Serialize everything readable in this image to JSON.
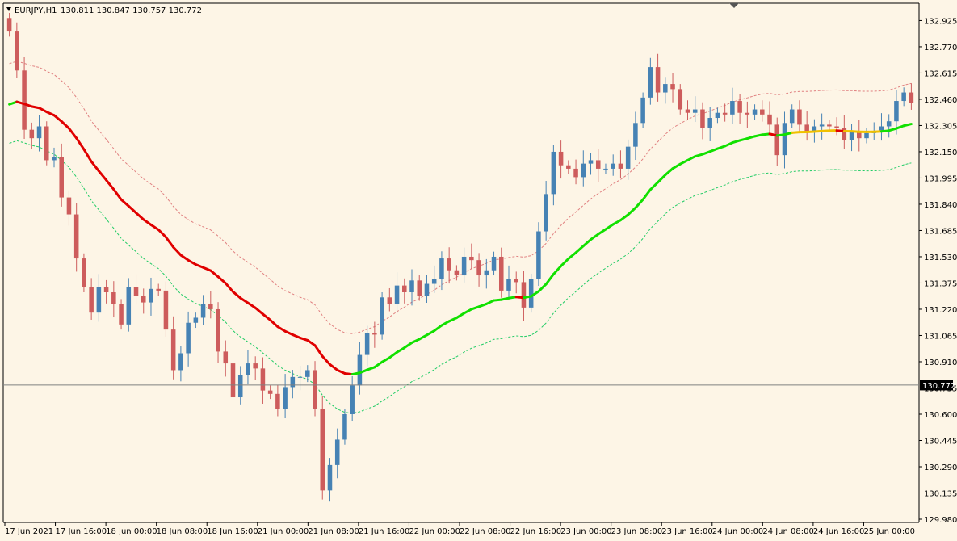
{
  "header": {
    "symbol": "EURJPY,H1",
    "ohlc": "130.811 130.847 130.757 130.772"
  },
  "colors": {
    "background": "#fdf5e6",
    "bull_candle": "#4682b4",
    "bear_candle": "#cd5c5c",
    "ma_down": "#e00000",
    "ma_up": "#11e000",
    "ma_flat": "#f0c000",
    "upper_band": "#e08080",
    "lower_band": "#22cc66",
    "price_line": "#808080"
  },
  "chart_data": {
    "type": "candlestick",
    "symbol": "EURJPY",
    "timeframe": "H1",
    "current_price": 130.772,
    "current_price_label": "130.772",
    "ylim": [
      129.98,
      132.97
    ],
    "y_ticks": [
      "132.925",
      "132.770",
      "132.615",
      "132.460",
      "132.305",
      "132.150",
      "131.995",
      "131.840",
      "131.685",
      "131.530",
      "131.375",
      "131.220",
      "131.065",
      "130.910",
      "130.755",
      "130.600",
      "130.445",
      "130.290",
      "130.135",
      "129.980"
    ],
    "x_ticks": [
      "17 Jun 2021",
      "17 Jun 16:00",
      "18 Jun 00:00",
      "18 Jun 08:00",
      "18 Jun 16:00",
      "21 Jun 00:00",
      "21 Jun 08:00",
      "21 Jun 16:00",
      "22 Jun 00:00",
      "22 Jun 08:00",
      "22 Jun 16:00",
      "23 Jun 00:00",
      "23 Jun 08:00",
      "23 Jun 16:00",
      "24 Jun 00:00",
      "24 Jun 08:00",
      "24 Jun 16:00",
      "25 Jun 00:00"
    ],
    "candles_close": [
      132.86,
      132.63,
      132.28,
      132.23,
      132.3,
      132.1,
      132.12,
      131.88,
      131.78,
      131.52,
      131.35,
      131.2,
      131.35,
      131.32,
      131.25,
      131.13,
      131.35,
      131.3,
      131.26,
      131.34,
      131.33,
      131.1,
      130.86,
      130.96,
      131.14,
      131.17,
      131.25,
      131.22,
      130.97,
      130.9,
      130.7,
      130.83,
      130.9,
      130.87,
      130.74,
      130.72,
      130.63,
      130.76,
      130.82,
      130.82,
      130.86,
      130.63,
      130.15,
      130.3,
      130.45,
      130.6,
      130.77,
      130.95,
      131.08,
      131.07,
      131.29,
      131.25,
      131.36,
      131.32,
      131.39,
      131.3,
      131.37,
      131.4,
      131.52,
      131.45,
      131.42,
      131.53,
      131.51,
      131.42,
      131.45,
      131.53,
      131.33,
      131.4,
      131.38,
      131.23,
      131.4,
      131.68,
      131.9,
      132.15,
      132.07,
      132.05,
      132.0,
      132.08,
      132.1,
      132.05,
      132.05,
      132.08,
      132.05,
      132.18,
      132.32,
      132.47,
      132.65,
      132.5,
      132.55,
      132.52,
      132.4,
      132.38,
      132.4,
      132.29,
      132.35,
      132.38,
      132.37,
      132.45,
      132.38,
      132.37,
      132.4,
      132.37,
      132.31,
      132.13,
      132.32,
      132.4,
      132.31,
      132.27,
      132.3,
      132.31,
      132.3,
      132.29,
      132.22,
      132.27,
      132.23,
      132.26,
      132.27,
      132.3,
      132.33,
      132.45,
      132.5,
      132.44
    ],
    "ma_first": 132.43,
    "band_offset_upper": 0.24,
    "band_offset_lower": -0.23
  }
}
